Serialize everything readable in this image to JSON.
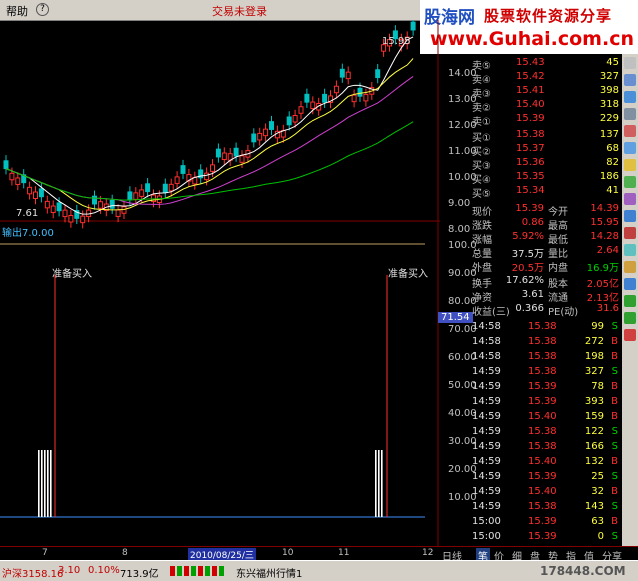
{
  "menu": {
    "help": "帮助",
    "title": "交易未登录"
  },
  "watermark": {
    "brand": "股海网",
    "slogan": "股票软件资源分享",
    "url": "www.Guhai.com.cn"
  },
  "chart": {
    "high_label": "15.95",
    "low_label": "7.61",
    "price_ticks": [
      "14.00",
      "13.00",
      "12.00",
      "11.00",
      "10.00",
      "9.00",
      "8.00"
    ],
    "indicator_name": "输出7.0.00",
    "indicator_ticks": [
      "100.0",
      "90.00",
      "80.00",
      "70.00",
      "60.00",
      "50.00",
      "40.00",
      "30.00",
      "20.00",
      "10.00"
    ],
    "signal_label": "准备买入",
    "cursor_value": "71.54",
    "x_labels": [
      "7",
      "8",
      "2010/08/25/三",
      "10",
      "11",
      "12"
    ]
  },
  "quote": {
    "asks": [
      {
        "label": "卖⑤",
        "price": "15.43",
        "vol": "45"
      },
      {
        "label": "卖④",
        "price": "15.42",
        "vol": "327"
      },
      {
        "label": "卖③",
        "price": "15.41",
        "vol": "398"
      },
      {
        "label": "卖②",
        "price": "15.40",
        "vol": "318"
      },
      {
        "label": "卖①",
        "price": "15.39",
        "vol": "229"
      }
    ],
    "bids": [
      {
        "label": "买①",
        "price": "15.38",
        "vol": "137"
      },
      {
        "label": "买②",
        "price": "15.37",
        "vol": "68"
      },
      {
        "label": "买③",
        "price": "15.36",
        "vol": "82"
      },
      {
        "label": "买④",
        "price": "15.35",
        "vol": "186"
      },
      {
        "label": "买⑤",
        "price": "15.34",
        "vol": "41"
      }
    ],
    "stats": [
      {
        "l1": "现价",
        "v1": "15.39",
        "l2": "今开",
        "v2": "14.39"
      },
      {
        "l1": "涨跌",
        "v1": "0.86",
        "l2": "最高",
        "v2": "15.95"
      },
      {
        "l1": "涨幅",
        "v1": "5.92%",
        "l2": "最低",
        "v2": "14.28"
      },
      {
        "l1": "总量",
        "v1": "37.5万",
        "l2": "量比",
        "v2": "2.64"
      },
      {
        "l1": "外盘",
        "v1": "20.5万",
        "l2": "内盘",
        "v2": "16.9万"
      },
      {
        "l1": "换手",
        "v1": "17.62%",
        "l2": "股本",
        "v2": "2.05亿"
      },
      {
        "l1": "净资",
        "v1": "3.61",
        "l2": "流通",
        "v2": "2.13亿"
      },
      {
        "l1": "收益(三)",
        "v1": "0.366",
        "l2": "PE(动)",
        "v2": "31.6"
      }
    ],
    "ticks": [
      {
        "t": "14:58",
        "p": "15.38",
        "v": "99",
        "s": "S"
      },
      {
        "t": "14:58",
        "p": "15.38",
        "v": "272",
        "s": "B"
      },
      {
        "t": "14:58",
        "p": "15.38",
        "v": "198",
        "s": "B"
      },
      {
        "t": "14:59",
        "p": "15.38",
        "v": "327",
        "s": "S"
      },
      {
        "t": "14:59",
        "p": "15.39",
        "v": "78",
        "s": "B"
      },
      {
        "t": "14:59",
        "p": "15.39",
        "v": "393",
        "s": "B"
      },
      {
        "t": "14:59",
        "p": "15.40",
        "v": "159",
        "s": "B"
      },
      {
        "t": "14:59",
        "p": "15.38",
        "v": "122",
        "s": "S"
      },
      {
        "t": "14:59",
        "p": "15.38",
        "v": "166",
        "s": "S"
      },
      {
        "t": "14:59",
        "p": "15.40",
        "v": "132",
        "b": "",
        "s": "B"
      },
      {
        "t": "14:59",
        "p": "15.39",
        "v": "25",
        "s": "S"
      },
      {
        "t": "14:59",
        "p": "15.40",
        "v": "32",
        "s": "B"
      },
      {
        "t": "14:59",
        "p": "15.38",
        "v": "143",
        "s": "S"
      },
      {
        "t": "15:00",
        "p": "15.39",
        "v": "63",
        "s": "B"
      },
      {
        "t": "15:00",
        "p": "15.39",
        "v": "0",
        "s": "S"
      }
    ]
  },
  "tabs": {
    "day": "日线",
    "items": [
      "笔",
      "价",
      "细",
      "盘",
      "势",
      "指",
      "值",
      "分享"
    ]
  },
  "status": {
    "index": "沪深3158.16",
    "change": "3.10",
    "pct": "0.10%",
    "amount": "713.9亿",
    "stock": "东兴福州行情1",
    "site": "178448.COM"
  },
  "colors": {
    "up": "#ff3030",
    "down": "#00d000",
    "ma_white": "#ffffff",
    "ma_yellow": "#ffff40",
    "ma_purple": "#d040d0",
    "ma_green": "#00c000"
  }
}
